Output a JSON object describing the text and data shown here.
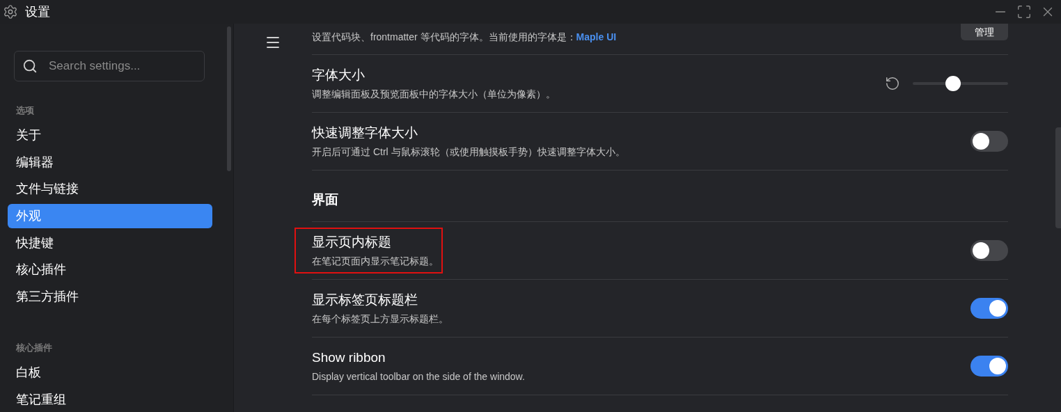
{
  "window": {
    "title": "设置"
  },
  "sidebar": {
    "search": {
      "placeholder": "Search settings..."
    },
    "groups": [
      {
        "heading": "选项",
        "items": [
          {
            "label": "关于",
            "selected": false
          },
          {
            "label": "编辑器",
            "selected": false
          },
          {
            "label": "文件与链接",
            "selected": false
          },
          {
            "label": "外观",
            "selected": true
          },
          {
            "label": "快捷键",
            "selected": false
          },
          {
            "label": "核心插件",
            "selected": false
          },
          {
            "label": "第三方插件",
            "selected": false
          }
        ]
      },
      {
        "heading": "核心插件",
        "items": [
          {
            "label": "白板",
            "selected": false
          },
          {
            "label": "笔记重组",
            "selected": false
          }
        ]
      }
    ]
  },
  "content": {
    "partial_row": {
      "description": "设置代码块、frontmatter 等代码的字体。当前使用的字体是：",
      "link": "Maple UI",
      "button": "管理"
    },
    "settings": [
      {
        "kind": "slider",
        "title": "字体大小",
        "description": "调整编辑面板及预览面板中的字体大小（单位为像素）。",
        "level": 0.42,
        "highlighted": false
      },
      {
        "kind": "toggle",
        "title": "快速调整字体大小",
        "description": "开启后可通过 Ctrl 与鼠标滚轮（或使用触摸板手势）快速调整字体大小。",
        "on": false,
        "highlighted": false
      }
    ],
    "section": {
      "heading": "界面",
      "settings": [
        {
          "kind": "toggle",
          "title": "显示页内标题",
          "description": "在笔记页面内显示笔记标题。",
          "on": false,
          "highlighted": true
        },
        {
          "kind": "toggle",
          "title": "显示标签页标题栏",
          "description": "在每个标签页上方显示标题栏。",
          "on": true,
          "highlighted": false
        },
        {
          "kind": "toggle",
          "title": "Show ribbon",
          "description": "Display vertical toolbar on the side of the window.",
          "on": true,
          "highlighted": false
        }
      ]
    }
  }
}
